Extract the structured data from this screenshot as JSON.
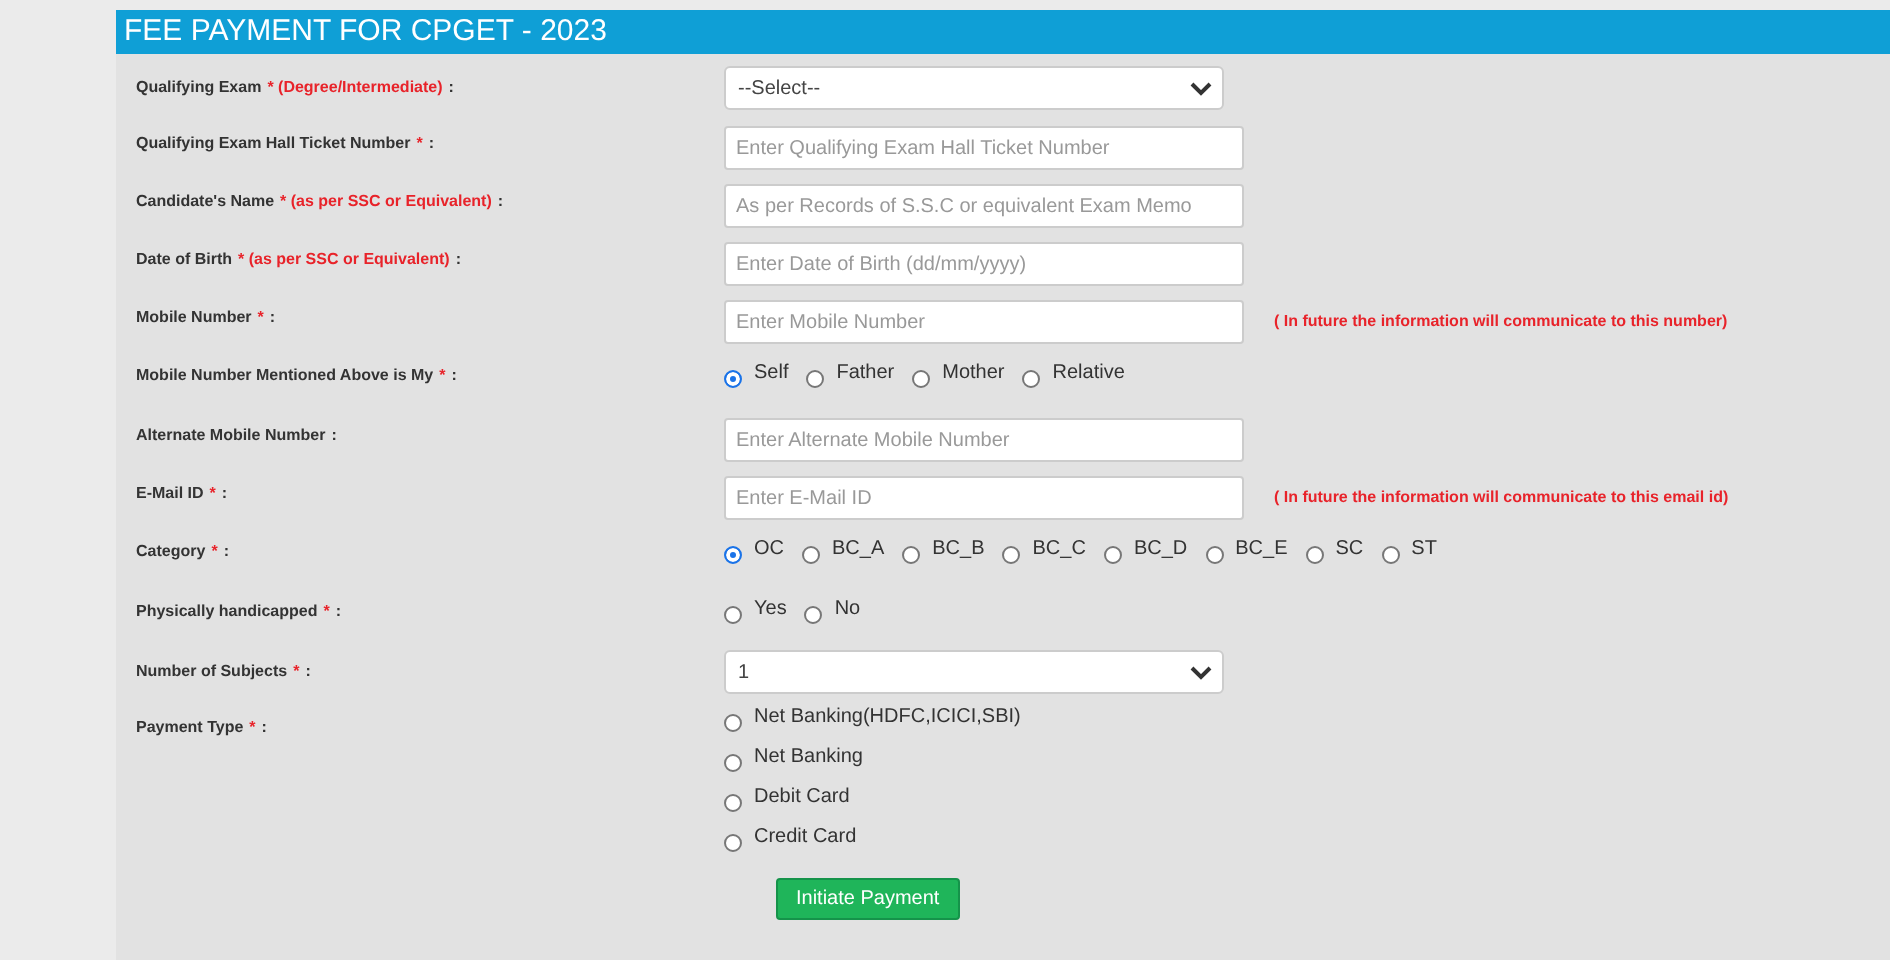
{
  "title": "FEE PAYMENT FOR CPGET - 2023",
  "fields": [
    {
      "kind": "select",
      "label": "Qualifying Exam",
      "mark": "* (Degree/Intermediate)",
      "colon": ":",
      "value": "--Select--"
    },
    {
      "kind": "text",
      "label": "Qualifying Exam Hall Ticket Number",
      "mark": "*",
      "colon": ":",
      "placeholder": "Enter Qualifying Exam Hall Ticket Number"
    },
    {
      "kind": "text",
      "label": "Candidate's Name",
      "mark": "* (as per SSC or Equivalent)",
      "colon": ":",
      "placeholder": "As per Records of S.S.C or equivalent Exam Memo"
    },
    {
      "kind": "text",
      "label": "Date of Birth",
      "mark": "* (as per SSC or Equivalent)",
      "colon": ":",
      "placeholder": "Enter Date of Birth (dd/mm/yyyy)"
    },
    {
      "kind": "text",
      "label": "Mobile Number",
      "mark": "*",
      "colon": ":",
      "placeholder": "Enter Mobile Number",
      "note": "( In future the information will communicate to this number)"
    },
    {
      "kind": "radio",
      "label": "Mobile Number Mentioned Above is My",
      "mark": "*",
      "colon": ":",
      "options": [
        {
          "label": "Self",
          "selected": true
        },
        {
          "label": "Father",
          "selected": false
        },
        {
          "label": "Mother",
          "selected": false
        },
        {
          "label": "Relative",
          "selected": false
        }
      ]
    },
    {
      "kind": "text",
      "label": "Alternate Mobile Number",
      "colon": ":",
      "placeholder": "Enter Alternate Mobile Number"
    },
    {
      "kind": "text",
      "label": "E-Mail ID",
      "mark": "*",
      "colon": ":",
      "placeholder": "Enter E-Mail ID",
      "note": "( In future the information will communicate to this email id)"
    },
    {
      "kind": "radio",
      "label": "Category",
      "mark": "*",
      "colon": ":",
      "options": [
        {
          "label": "OC",
          "selected": true
        },
        {
          "label": "BC_A",
          "selected": false
        },
        {
          "label": "BC_B",
          "selected": false
        },
        {
          "label": "BC_C",
          "selected": false
        },
        {
          "label": "BC_D",
          "selected": false
        },
        {
          "label": "BC_E",
          "selected": false
        },
        {
          "label": "SC",
          "selected": false
        },
        {
          "label": "ST",
          "selected": false
        }
      ]
    },
    {
      "kind": "radio",
      "label": "Physically handicapped",
      "mark": "*",
      "colon": ":",
      "options": [
        {
          "label": "Yes",
          "selected": false
        },
        {
          "label": "No",
          "selected": false
        }
      ]
    },
    {
      "kind": "select",
      "label": "Number of Subjects",
      "mark": "*",
      "colon": ":",
      "value": "1"
    },
    {
      "kind": "radiolist",
      "label": "Payment Type",
      "mark": "*",
      "colon": ":",
      "options": [
        {
          "label": "Net Banking(HDFC,ICICI,SBI)",
          "selected": false
        },
        {
          "label": "Net Banking",
          "selected": false
        },
        {
          "label": "Debit Card",
          "selected": false
        },
        {
          "label": "Credit Card",
          "selected": false
        }
      ]
    }
  ],
  "submit": "Initiate Payment"
}
